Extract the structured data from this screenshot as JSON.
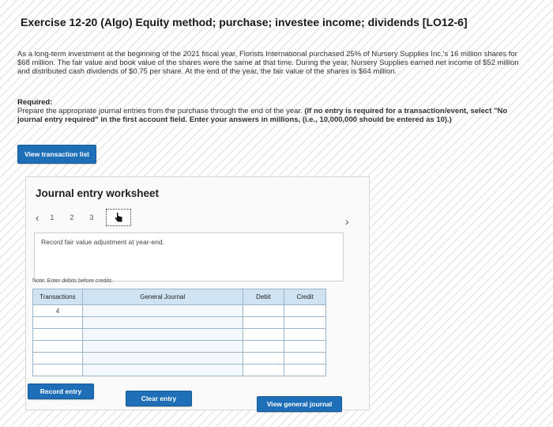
{
  "exercise_title": "Exercise 12-20 (Algo) Equity method; purchase; investee income; dividends [LO12-6]",
  "intro_text": "As a long-term investment at the beginning of the 2021 fiscal year, Florists International purchased 25% of Nursery Supplies Inc.'s 16 million shares for $68 million. The fair value and book value of the shares were the same at that time. During the year, Nursery Supplies earned net income of $52 million and distributed cash dividends of $0.75 per share. At the end of the year, the fair value of the shares is $64 million.",
  "required": {
    "heading": "Required:",
    "text_plain": "Prepare the appropriate journal entries from the purchase through the end of the year.",
    "text_bold": "(If no entry is required for a transaction/event, select \"No journal entry required\" in the first account field. Enter your answers in millions, (i.e., 10,000,000 should be entered as 10).)"
  },
  "view_transaction_list_label": "View transaction list",
  "worksheet": {
    "title": "Journal entry worksheet",
    "pages": [
      "1",
      "2",
      "3"
    ],
    "instruction": "Record fair value adjustment at year-end.",
    "note": "Note: Enter debits before credits.",
    "columns": {
      "transactions": "Transactions",
      "general_journal": "General Journal",
      "debit": "Debit",
      "credit": "Credit"
    },
    "rows": [
      {
        "transaction": "4",
        "account": "",
        "debit": "",
        "credit": ""
      },
      {
        "transaction": "",
        "account": "",
        "debit": "",
        "credit": ""
      },
      {
        "transaction": "",
        "account": "",
        "debit": "",
        "credit": ""
      },
      {
        "transaction": "",
        "account": "",
        "debit": "",
        "credit": ""
      },
      {
        "transaction": "",
        "account": "",
        "debit": "",
        "credit": ""
      },
      {
        "transaction": "",
        "account": "",
        "debit": "",
        "credit": ""
      }
    ],
    "buttons": {
      "record_entry": "Record entry",
      "clear_entry": "Clear entry",
      "view_general_journal": "View general journal"
    }
  },
  "colors": {
    "button_blue": "#1f6fb8",
    "table_header": "#cfe3f3"
  }
}
